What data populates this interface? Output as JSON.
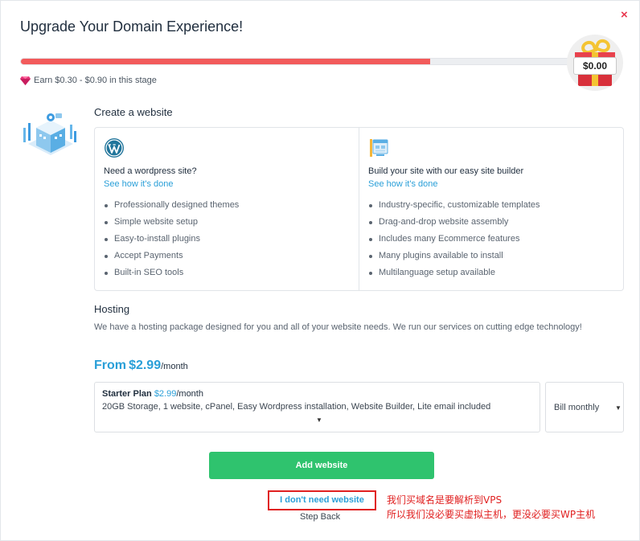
{
  "modal": {
    "title": "Upgrade Your Domain Experience!",
    "close_label": "×"
  },
  "progress": {
    "fraction": 0.74,
    "fill_color": "#f25b5b",
    "reward_badge": "$0.00",
    "earn_text": "Earn $0.30 - $0.90 in this stage",
    "earn_icon": "gem-icon"
  },
  "website": {
    "heading": "Create a website",
    "options": [
      {
        "icon": "wordpress-icon",
        "title": "Need a wordpress site?",
        "link": "See how it's done",
        "features": [
          "Professionally designed themes",
          "Simple website setup",
          "Easy-to-install plugins",
          "Accept Payments",
          "Built-in SEO tools"
        ]
      },
      {
        "icon": "site-builder-icon",
        "title": "Build your site with our easy site builder",
        "link": "See how it's done",
        "features": [
          "Industry-specific, customizable templates",
          "Drag-and-drop website assembly",
          "Includes many Ecommerce features",
          "Many plugins available to install",
          "Multilanguage setup available"
        ]
      }
    ]
  },
  "hosting": {
    "heading": "Hosting",
    "description": "We have a hosting package designed for you and all of your website needs. We run our services on cutting edge technology!",
    "from_label": "From",
    "from_price": "$2.99",
    "per_month": "/month",
    "plan": {
      "name": "Starter Plan",
      "price": "$2.99",
      "per": "/month",
      "details": "20GB Storage, 1 website, cPanel, Easy Wordpress installation, Website Builder, Lite email included"
    },
    "billing": {
      "selected": "Bill monthly"
    }
  },
  "actions": {
    "add_website": "Add website",
    "no_website": "I don't need website",
    "step_back": "Step Back"
  },
  "annotation": {
    "line1": "我们买域名是要解析到VPS",
    "line2": "所以我们没必要买虚拟主机，更没必要买WP主机"
  },
  "colors": {
    "accent_blue": "#2a9fd8",
    "button_green": "#2fc36e",
    "close_red": "#e8384f",
    "annotation_red": "#e02020"
  }
}
